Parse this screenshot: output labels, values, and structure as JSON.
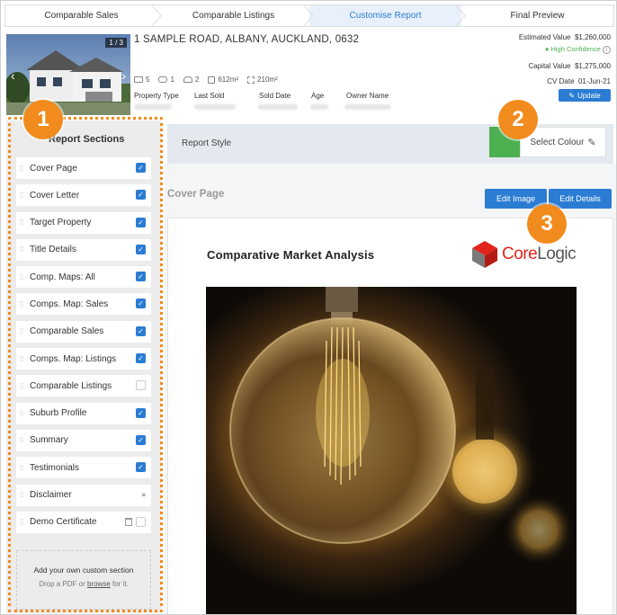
{
  "steps": [
    {
      "label": "Comparable Sales"
    },
    {
      "label": "Comparable Listings"
    },
    {
      "label": "Customise Report"
    },
    {
      "label": "Final Preview"
    }
  ],
  "property": {
    "photo_counter": "1 / 3",
    "address": "1 SAMPLE ROAD, ALBANY, AUCKLAND, 0632",
    "beds": "5",
    "baths": "1",
    "cars": "2",
    "land": "612m²",
    "floor": "210m²",
    "meta_labels": [
      "Property Type",
      "Last Sold",
      "Sold Date",
      "Age",
      "Owner Name"
    ],
    "estimated_label": "Estimated Value",
    "estimated_value": "$1,260,000",
    "confidence": "High Confidence",
    "capital_label": "Capital Value",
    "capital_value": "$1,275,000",
    "cv_label": "CV Date",
    "cv_date": "01-Jun-21",
    "update_label": "Update"
  },
  "sidebar": {
    "title": "Report Sections",
    "items": [
      {
        "label": "Cover Page",
        "state": "checked"
      },
      {
        "label": "Cover Letter",
        "state": "checked"
      },
      {
        "label": "Target Property",
        "state": "checked"
      },
      {
        "label": "Title Details",
        "state": "checked"
      },
      {
        "label": "Comp. Maps: All",
        "state": "checked"
      },
      {
        "label": "Comps. Map: Sales",
        "state": "checked"
      },
      {
        "label": "Comparable Sales",
        "state": "checked"
      },
      {
        "label": "Comps. Map: Listings",
        "state": "checked"
      },
      {
        "label": "Comparable Listings",
        "state": "unchecked"
      },
      {
        "label": "Suburb Profile",
        "state": "checked"
      },
      {
        "label": "Summary",
        "state": "checked"
      },
      {
        "label": "Testimonials",
        "state": "checked"
      },
      {
        "label": "Disclaimer",
        "state": "locked"
      },
      {
        "label": "Demo Certificate",
        "state": "trash-unchecked"
      }
    ],
    "custom_heading": "Add your own custom section",
    "custom_text_before": "Drop a PDF or ",
    "custom_link": "browse",
    "custom_text_after": " for it."
  },
  "report_style": {
    "label": "Report Style",
    "colour": "#4caf50",
    "select_label": "Select Colour"
  },
  "cover": {
    "section_title": "Cover Page",
    "edit_image_label": "Edit Image",
    "edit_details_label": "Edit Details",
    "report_title": "Comparative Market Analysis",
    "logo_core": "Core",
    "logo_logic": "Logic"
  },
  "callouts": [
    "1",
    "2",
    "3"
  ],
  "colors": {
    "accent": "#2b7cd3",
    "callout": "#f28b1e",
    "brand_red": "#e2231a"
  }
}
